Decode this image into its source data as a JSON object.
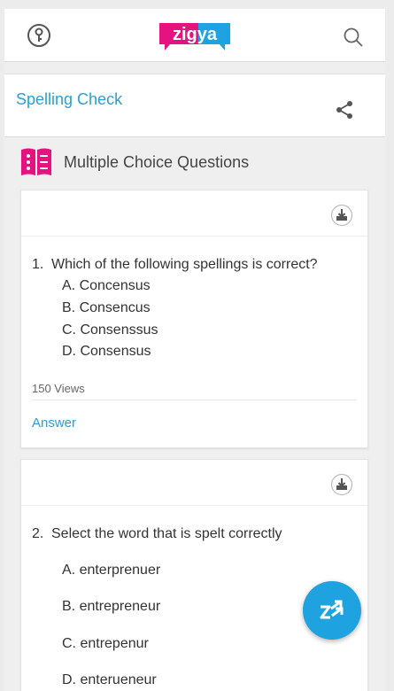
{
  "header": {
    "logo_text": "zigya",
    "key_icon": "key-icon",
    "search_icon": "search-icon"
  },
  "page": {
    "title": "Spelling Check",
    "share_icon": "share-icon"
  },
  "section": {
    "title": "Multiple Choice Questions",
    "icon": "mcq-book-icon"
  },
  "questions": [
    {
      "number": "1.",
      "text": "Which of the following spellings is correct?",
      "options": [
        "A. Concensus",
        "B. Consencus",
        "C. Consenssus",
        "D. Consensus"
      ],
      "views": "150 Views",
      "answer_label": "Answer"
    },
    {
      "number": "2.",
      "text": "Select the word that is spelt correctly",
      "options": [
        "A. enterprenuer",
        "B. entrepreneur",
        "C. entrepenur",
        "D. enterueneur"
      ]
    }
  ],
  "fab": {
    "icon": "zigya-chat-icon"
  },
  "colors": {
    "accent": "#2a9fd6",
    "brand_pink": "#e5137f",
    "brand_blue": "#1ea2e0"
  }
}
